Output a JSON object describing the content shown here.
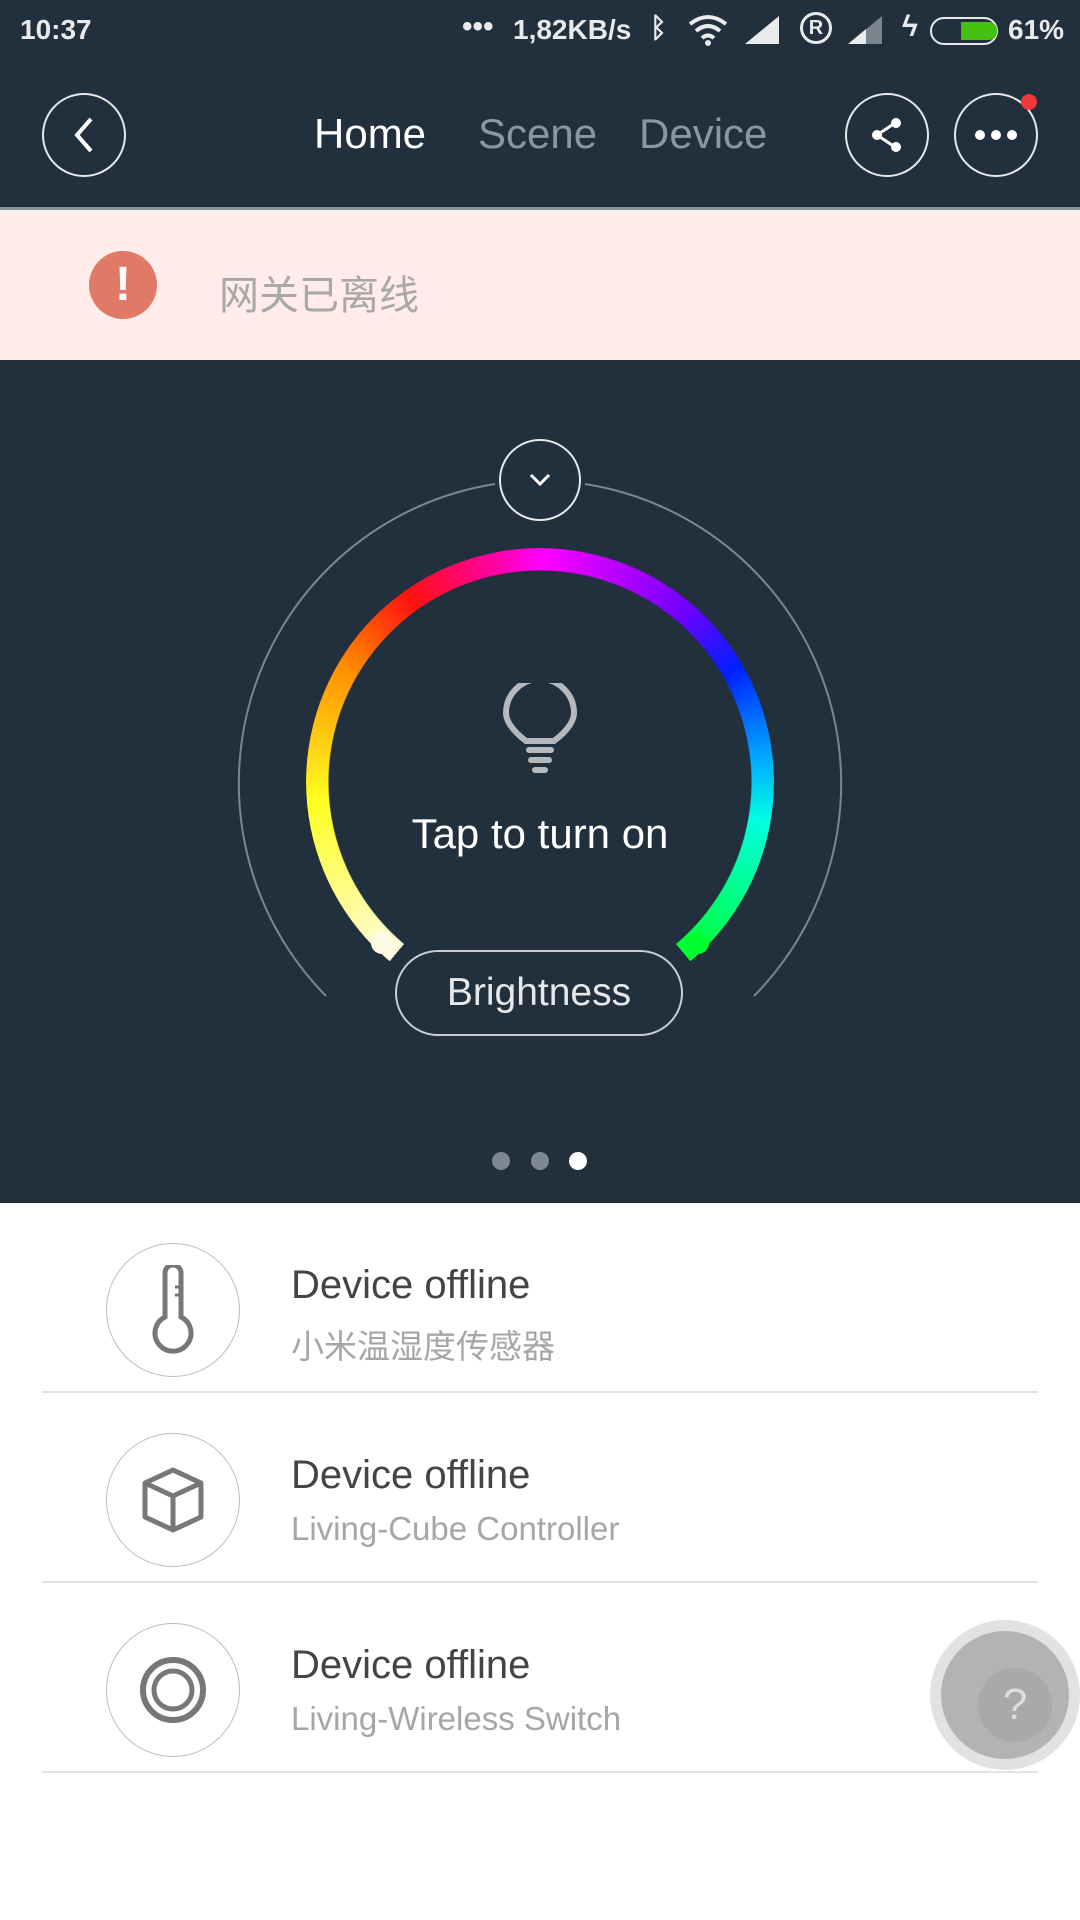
{
  "status_bar": {
    "time": "10:37",
    "net_speed": "1,82KB/s",
    "battery": "61%",
    "battery_level": 0.61
  },
  "header": {
    "tabs": [
      {
        "label": "Home",
        "active": true
      },
      {
        "label": "Scene",
        "active": false
      },
      {
        "label": "Device",
        "active": false
      }
    ],
    "more_has_notification": true
  },
  "banner": {
    "text": "网关已离线",
    "icon": "exclamation-icon",
    "color": "#e07a66"
  },
  "control": {
    "prompt": "Tap to turn on",
    "brightness_label": "Brightness",
    "page_count": 3,
    "active_page": 3
  },
  "devices": [
    {
      "status": "Device offline",
      "name": "小米温湿度传感器",
      "icon": "thermometer-icon"
    },
    {
      "status": "Device offline",
      "name": "Living-Cube Controller",
      "icon": "cube-icon"
    },
    {
      "status": "Device offline",
      "name": "Living-Wireless Switch",
      "icon": "switch-icon"
    }
  ],
  "help": {
    "label": "?"
  }
}
